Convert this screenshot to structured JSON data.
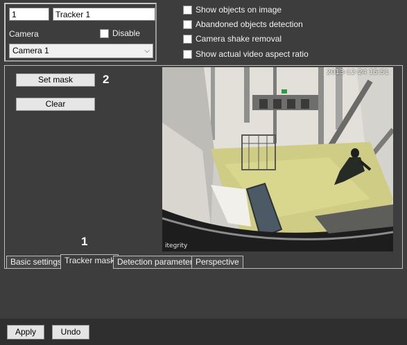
{
  "object": {
    "id": "1",
    "name": "Tracker 1",
    "camera_label": "Camera",
    "disable_label": "Disable",
    "camera_selected": "Camera 1"
  },
  "options": [
    {
      "label": "Show objects on image",
      "checked": false
    },
    {
      "label": "Abandoned objects detection",
      "checked": false
    },
    {
      "label": "Camera shake removal",
      "checked": false
    },
    {
      "label": "Show actual video aspect ratio",
      "checked": false
    }
  ],
  "mask_panel": {
    "set_mask_label": "Set mask",
    "clear_label": "Clear",
    "callout_2": "2",
    "callout_1": "1"
  },
  "video": {
    "timestamp": "2013-12-24 15:51",
    "watermark": "itegrity"
  },
  "tabs": [
    {
      "label": "Basic settings",
      "active": false
    },
    {
      "label": "Tracker mask",
      "active": true
    },
    {
      "label": "Detection parameters",
      "active": false
    },
    {
      "label": "Perspective",
      "active": false
    }
  ],
  "footer": {
    "apply_label": "Apply",
    "undo_label": "Undo"
  }
}
